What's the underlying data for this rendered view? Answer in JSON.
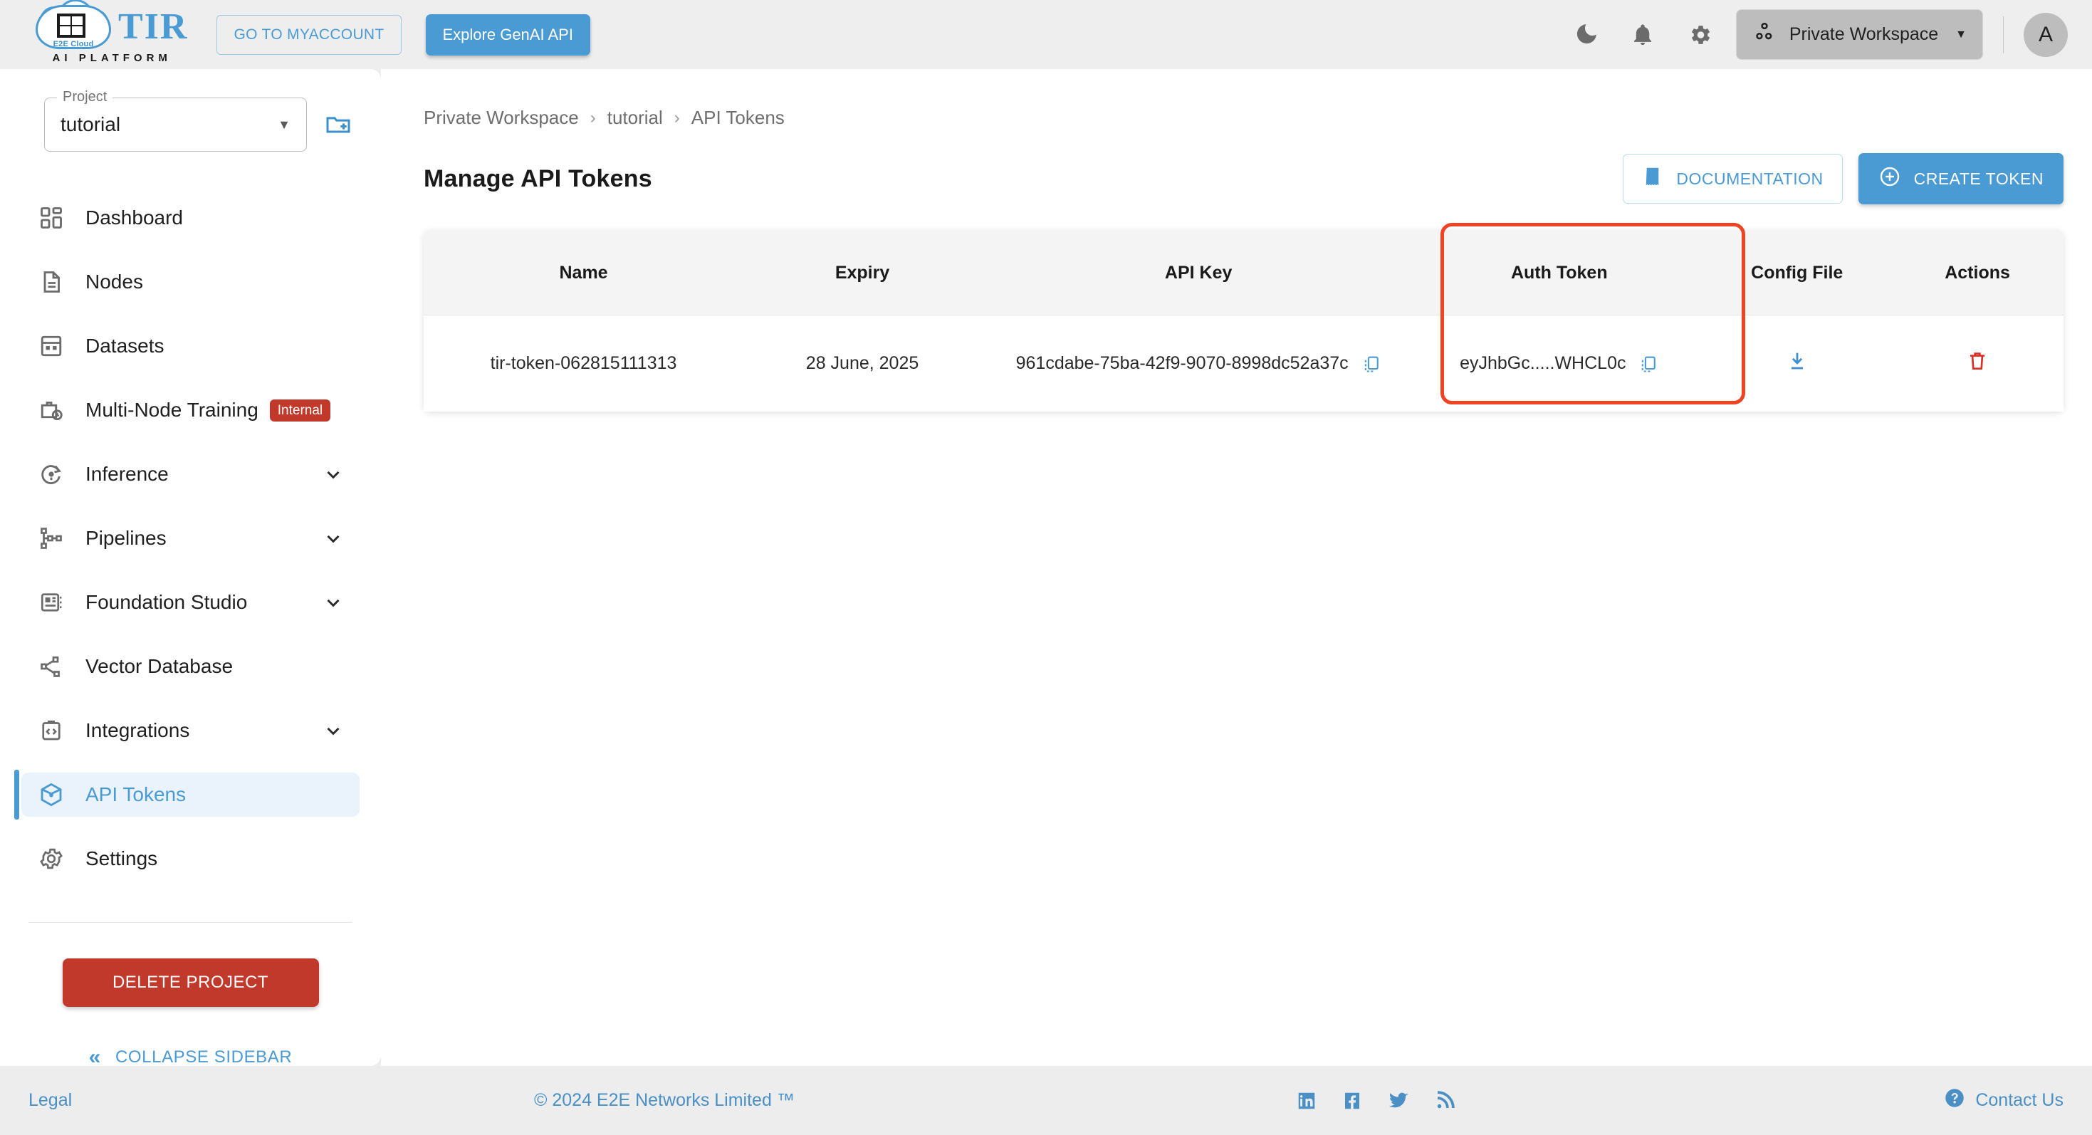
{
  "topbar": {
    "logo_title": "TIR",
    "logo_subtitle": "AI PLATFORM",
    "logo_badge": "E2E Cloud",
    "myaccount_label": "GO TO MYACCOUNT",
    "genai_label": "Explore GenAI API",
    "workspace_label": "Private Workspace",
    "avatar_initial": "A",
    "icons": [
      "moon-icon",
      "bell-icon",
      "gear-icon"
    ]
  },
  "sidebar": {
    "project_legend": "Project",
    "project_value": "tutorial",
    "items": [
      {
        "label": "Dashboard",
        "icon": "dashboard-icon",
        "chevron": false,
        "badge": "",
        "active": false
      },
      {
        "label": "Nodes",
        "icon": "document-icon",
        "chevron": false,
        "badge": "",
        "active": false
      },
      {
        "label": "Datasets",
        "icon": "grid-table-icon",
        "chevron": false,
        "badge": "",
        "active": false
      },
      {
        "label": "Multi-Node Training",
        "icon": "briefcase-clock-icon",
        "chevron": false,
        "badge": "Internal",
        "active": false
      },
      {
        "label": "Inference",
        "icon": "inference-icon",
        "chevron": true,
        "badge": "",
        "active": false
      },
      {
        "label": "Pipelines",
        "icon": "pipeline-icon",
        "chevron": true,
        "badge": "",
        "active": false
      },
      {
        "label": "Foundation Studio",
        "icon": "foundation-icon",
        "chevron": true,
        "badge": "",
        "active": false
      },
      {
        "label": "Vector Database",
        "icon": "share-nodes-icon",
        "chevron": false,
        "badge": "",
        "active": false
      },
      {
        "label": "Integrations",
        "icon": "code-clipboard-icon",
        "chevron": true,
        "badge": "",
        "active": false
      },
      {
        "label": "API Tokens",
        "icon": "cube-icon",
        "chevron": false,
        "badge": "",
        "active": true
      },
      {
        "label": "Settings",
        "icon": "settings-gear-icon",
        "chevron": false,
        "badge": "",
        "active": false
      }
    ],
    "delete_project_label": "DELETE PROJECT",
    "collapse_label": "COLLAPSE SIDEBAR"
  },
  "main": {
    "breadcrumb": [
      "Private Workspace",
      "tutorial",
      "API Tokens"
    ],
    "breadcrumb_separator": "›",
    "page_title": "Manage API Tokens",
    "documentation_label": "DOCUMENTATION",
    "create_token_label": "CREATE TOKEN",
    "table": {
      "columns": [
        "Name",
        "Expiry",
        "API Key",
        "Auth Token",
        "Config File",
        "Actions"
      ],
      "rows": [
        {
          "name": "tir-token-062815111313",
          "expiry": "28 June, 2025",
          "api_key": "961cdabe-75ba-42f9-9070-8998dc52a37c",
          "auth_token": "eyJhbGc.....WHCL0c",
          "config_file_icon": "download-icon",
          "action_icon": "trash-icon"
        }
      ],
      "highlighted_column": "Auth Token"
    }
  },
  "footer": {
    "legal": "Legal",
    "copyright": "© 2024 E2E Networks Limited ™",
    "socials": [
      "linkedin-icon",
      "facebook-icon",
      "twitter-icon",
      "rss-icon"
    ],
    "contact": "Contact Us"
  },
  "colors": {
    "accent_blue": "#4a9ad4",
    "danger_red": "#c0392b",
    "highlight_orange": "#ef4423",
    "trash_red": "#d93025",
    "page_bg": "#eeeeee"
  }
}
